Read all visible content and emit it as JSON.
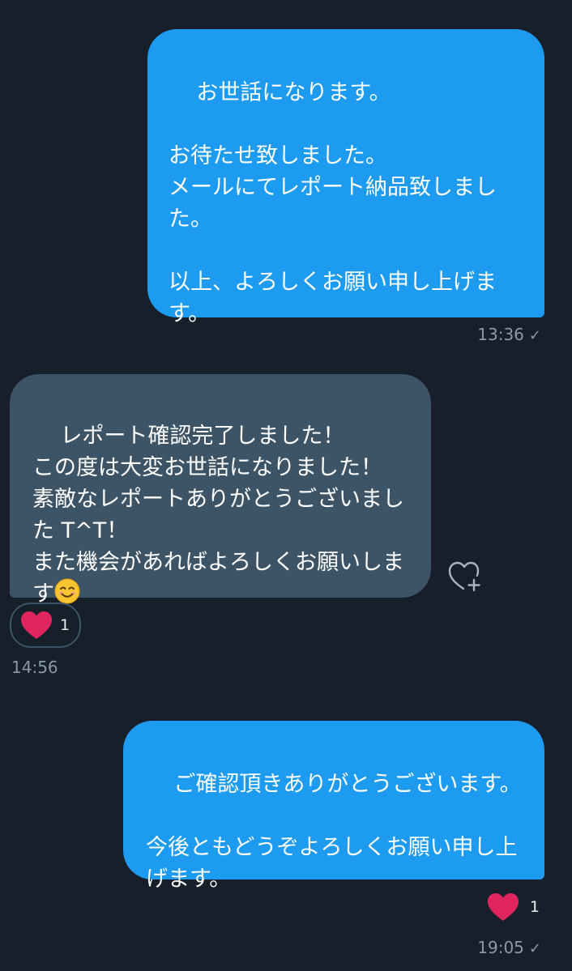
{
  "messages": [
    {
      "direction": "sent",
      "text": "お世話になります。\n\nお待たせ致しました。\nメールにてレポート納品致しました。\n\n以上、よろしくお願い申し上げます。",
      "time": "13:36"
    },
    {
      "direction": "received",
      "text_main": "レポート確認完了しました！\nこの度は大変お世話になりました！\n素敵なレポートありがとうございました T^T！\nまた機会があればよろしくお願いします",
      "emoji": "smiling-face-emoji",
      "reaction_count": "1",
      "time": "14:56"
    },
    {
      "direction": "sent",
      "text": "ご確認頂きありがとうございます。\n\n今後ともどうぞよろしくお願い申し上げます。",
      "reaction_count": "1",
      "time": "19:05"
    }
  ],
  "colors": {
    "background": "#17202a",
    "sent_bubble": "#1d9bf0",
    "received_bubble": "#3d5466",
    "heart": "#e0245e",
    "timestamp": "#8b98a5"
  },
  "icons": {
    "read_receipt": "checkmark-icon",
    "add_reaction": "heart-plus-icon",
    "reaction": "heart-icon"
  }
}
